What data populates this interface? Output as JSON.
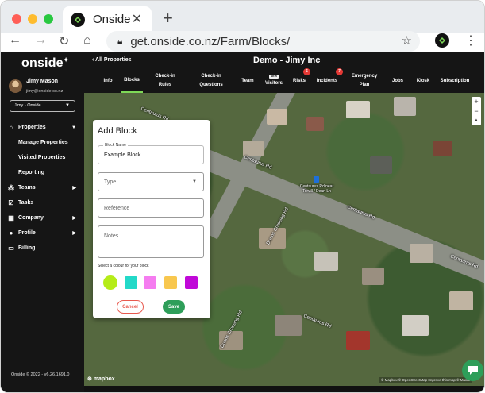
{
  "browser": {
    "tab_title": "Onside",
    "url": "get.onside.co.nz/Farm/Blocks/"
  },
  "sidebar": {
    "logo": "onside",
    "user_name": "Jimy Mason",
    "user_email": "jimy@onside.co.nz",
    "farm_select": "Jimy - Onside",
    "items": [
      {
        "label": "Properties",
        "icon": "home-icon"
      },
      {
        "label": "Manage Properties"
      },
      {
        "label": "Visited Properties"
      },
      {
        "label": "Reporting"
      },
      {
        "label": "Teams",
        "icon": "team-icon"
      },
      {
        "label": "Tasks",
        "icon": "task-icon"
      },
      {
        "label": "Company",
        "icon": "company-icon"
      },
      {
        "label": "Profile",
        "icon": "profile-icon"
      },
      {
        "label": "Billing",
        "icon": "billing-icon"
      }
    ],
    "footer": "Onside © 2022 - v6.26.1691.0"
  },
  "header": {
    "back_label": "All Properties",
    "farm_title": "Demo - Jimy Inc",
    "tabs": [
      {
        "label": "Info"
      },
      {
        "label": "Blocks"
      },
      {
        "label": "Check-in",
        "label2": "Rules"
      },
      {
        "label": "Check-in",
        "label2": "Questions"
      },
      {
        "label": "Team"
      },
      {
        "label": "Visitors",
        "new": "NEW"
      },
      {
        "label": "Risks",
        "badge": "6"
      },
      {
        "label": "Incidents",
        "badge": "7"
      },
      {
        "label": "Emergency",
        "label2": "Plan"
      },
      {
        "label": "Jobs"
      },
      {
        "label": "Kiosk"
      },
      {
        "label": "Subscription"
      }
    ]
  },
  "map": {
    "labels": {
      "road1": "Centaurus Rd",
      "road2": "Centaurus Rd",
      "road3": "Centaurus Rd",
      "road4": "Centaurus Rd",
      "road5": "Dunns Crossing Rd",
      "road6": "Dunns Crossing Rd",
      "stop": "Centaurus Rd near Torvill / Dean Ln",
      "road7": "Centaurus Rd"
    },
    "zoom_in": "+",
    "zoom_out": "−",
    "mapbox_logo": "mapbox",
    "attribution": "© Mapbox © OpenStreetMap Improve this map © Maxar"
  },
  "modal": {
    "title": "Add Block",
    "block_name_label": "Block Name",
    "block_name_value": "Example Block",
    "type_placeholder": "Type",
    "reference_placeholder": "Reference",
    "notes_placeholder": "Notes",
    "colour_label": "Select a colour for your block",
    "colours": [
      "#b5ec18",
      "#23d9c8",
      "#f57cf0",
      "#f8c74e",
      "#c008d8"
    ],
    "cancel_label": "Cancel",
    "save_label": "Save"
  },
  "colors": {
    "accent": "#2e9e59",
    "active_tab": "#7ed957",
    "badge": "#e53935",
    "cancel": "#e85a4f"
  }
}
